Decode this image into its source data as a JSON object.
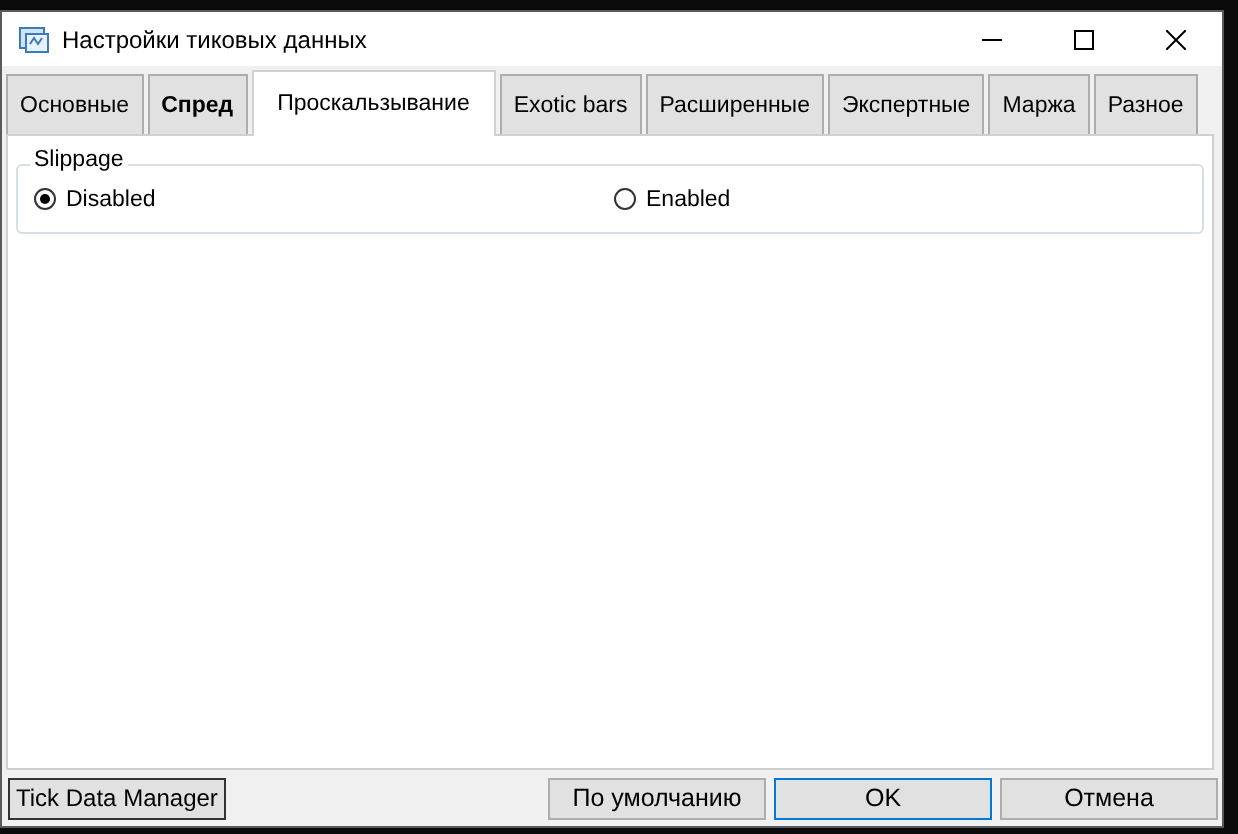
{
  "window": {
    "title": "Настройки тиковых данных"
  },
  "tabs": [
    {
      "label": "Основные",
      "selected": false,
      "bold": false
    },
    {
      "label": "Спред",
      "selected": false,
      "bold": true
    },
    {
      "label": "Проскальзывание",
      "selected": true,
      "bold": false
    },
    {
      "label": "Exotic bars",
      "selected": false,
      "bold": false
    },
    {
      "label": "Расширенные",
      "selected": false,
      "bold": false
    },
    {
      "label": "Экспертные",
      "selected": false,
      "bold": false
    },
    {
      "label": "Маржа",
      "selected": false,
      "bold": false
    },
    {
      "label": "Разное",
      "selected": false,
      "bold": false
    }
  ],
  "group": {
    "title": "Slippage",
    "options": [
      {
        "label": "Disabled",
        "selected": true
      },
      {
        "label": "Enabled",
        "selected": false
      }
    ]
  },
  "footer": {
    "left_button": "Tick Data Manager",
    "buttons": [
      {
        "label": "По умолчанию",
        "default": false
      },
      {
        "label": "OK",
        "default": true
      },
      {
        "label": "Отмена",
        "default": false
      }
    ]
  }
}
